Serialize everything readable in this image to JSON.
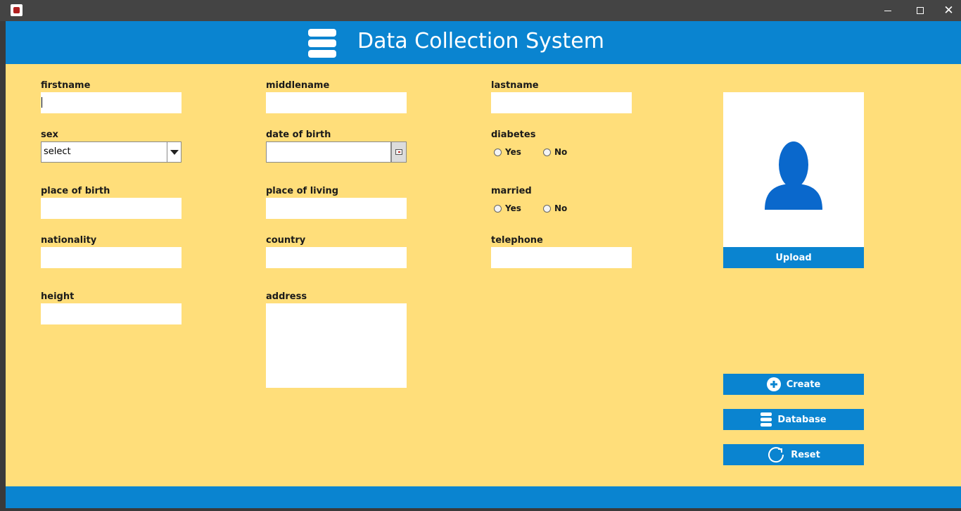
{
  "window": {
    "minimize_icon": "minimize-icon",
    "maximize_icon": "maximize-icon",
    "close_glyph": "✕"
  },
  "header": {
    "title": "Data Collection System",
    "icon": "database-icon",
    "color": "#0a84d0"
  },
  "form": {
    "firstname": {
      "label": "firstname",
      "value": ""
    },
    "middlename": {
      "label": "middlename",
      "value": ""
    },
    "lastname": {
      "label": "lastname",
      "value": ""
    },
    "sex": {
      "label": "sex",
      "selected": "select"
    },
    "date_of_birth": {
      "label": "date of birth",
      "value": ""
    },
    "diabetes": {
      "label": "diabetes",
      "yes": "Yes",
      "no": "No"
    },
    "place_of_birth": {
      "label": "place of birth",
      "value": ""
    },
    "place_of_living": {
      "label": "place of living",
      "value": ""
    },
    "married": {
      "label": "married",
      "yes": "Yes",
      "no": "No"
    },
    "nationality": {
      "label": "nationality",
      "value": ""
    },
    "country": {
      "label": "country",
      "value": ""
    },
    "telephone": {
      "label": "telephone",
      "value": ""
    },
    "height": {
      "label": "height",
      "value": ""
    },
    "address": {
      "label": "address",
      "value": ""
    }
  },
  "photo": {
    "placeholder_icon": "person-icon",
    "upload_label": "Upload"
  },
  "actions": {
    "create": {
      "label": "Create",
      "icon": "plus-circle-icon"
    },
    "database": {
      "label": "Database",
      "icon": "database-icon"
    },
    "reset": {
      "label": "Reset",
      "icon": "refresh-icon"
    }
  },
  "colors": {
    "background": "#ffde7a",
    "accent": "#0a84d0"
  }
}
